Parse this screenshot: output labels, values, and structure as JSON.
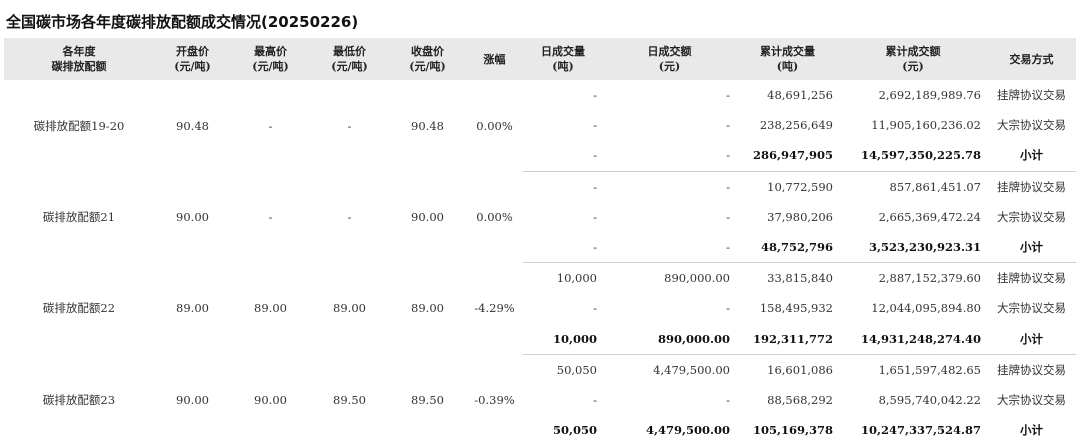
{
  "title": "全国碳市场各年度碳排放配额成交情况(20250226)",
  "headers": [
    [
      "各年度",
      "碳排放配额"
    ],
    [
      "开盘价",
      "(元/吨)"
    ],
    [
      "最高价",
      "(元/吨)"
    ],
    [
      "最低价",
      "(元/吨)"
    ],
    [
      "收盘价",
      "(元/吨)"
    ],
    [
      "涨幅"
    ],
    [
      "日成交量",
      "(吨)"
    ],
    [
      "日成交额",
      "(元)"
    ],
    [
      "累计成交量",
      "(吨)"
    ],
    [
      "累计成交额",
      "(元)"
    ],
    [
      "交易方式"
    ]
  ],
  "groups": [
    {
      "name": "碳排放配额19-20",
      "open": "90.48",
      "high": "-",
      "low": "-",
      "close": "90.48",
      "change": "0.00%",
      "rows": [
        {
          "daily_volume": "-",
          "daily_amount": "-",
          "cum_volume": "48,691,256",
          "cum_amount": "2,692,189,989.76",
          "method": "挂牌协议交易"
        },
        {
          "daily_volume": "-",
          "daily_amount": "-",
          "cum_volume": "238,256,649",
          "cum_amount": "11,905,160,236.02",
          "method": "大宗协议交易"
        },
        {
          "daily_volume": "-",
          "daily_amount": "-",
          "cum_volume": "286,947,905",
          "cum_amount": "14,597,350,225.78",
          "method": "小计"
        }
      ]
    },
    {
      "name": "碳排放配额21",
      "open": "90.00",
      "high": "-",
      "low": "-",
      "close": "90.00",
      "change": "0.00%",
      "rows": [
        {
          "daily_volume": "-",
          "daily_amount": "-",
          "cum_volume": "10,772,590",
          "cum_amount": "857,861,451.07",
          "method": "挂牌协议交易"
        },
        {
          "daily_volume": "-",
          "daily_amount": "-",
          "cum_volume": "37,980,206",
          "cum_amount": "2,665,369,472.24",
          "method": "大宗协议交易"
        },
        {
          "daily_volume": "-",
          "daily_amount": "-",
          "cum_volume": "48,752,796",
          "cum_amount": "3,523,230,923.31",
          "method": "小计"
        }
      ]
    },
    {
      "name": "碳排放配额22",
      "open": "89.00",
      "high": "89.00",
      "low": "89.00",
      "close": "89.00",
      "change": "-4.29%",
      "rows": [
        {
          "daily_volume": "10,000",
          "daily_amount": "890,000.00",
          "cum_volume": "33,815,840",
          "cum_amount": "2,887,152,379.60",
          "method": "挂牌协议交易"
        },
        {
          "daily_volume": "-",
          "daily_amount": "-",
          "cum_volume": "158,495,932",
          "cum_amount": "12,044,095,894.80",
          "method": "大宗协议交易"
        },
        {
          "daily_volume": "10,000",
          "daily_amount": "890,000.00",
          "cum_volume": "192,311,772",
          "cum_amount": "14,931,248,274.40",
          "method": "小计"
        }
      ]
    },
    {
      "name": "碳排放配额23",
      "open": "90.00",
      "high": "90.00",
      "low": "89.50",
      "close": "89.50",
      "change": "-0.39%",
      "rows": [
        {
          "daily_volume": "50,050",
          "daily_amount": "4,479,500.00",
          "cum_volume": "16,601,086",
          "cum_amount": "1,651,597,482.65",
          "method": "挂牌协议交易"
        },
        {
          "daily_volume": "-",
          "daily_amount": "-",
          "cum_volume": "88,568,292",
          "cum_amount": "8,595,740,042.22",
          "method": "大宗协议交易"
        },
        {
          "daily_volume": "50,050",
          "daily_amount": "4,479,500.00",
          "cum_volume": "105,169,378",
          "cum_amount": "10,247,337,524.87",
          "method": "小计"
        }
      ]
    }
  ]
}
